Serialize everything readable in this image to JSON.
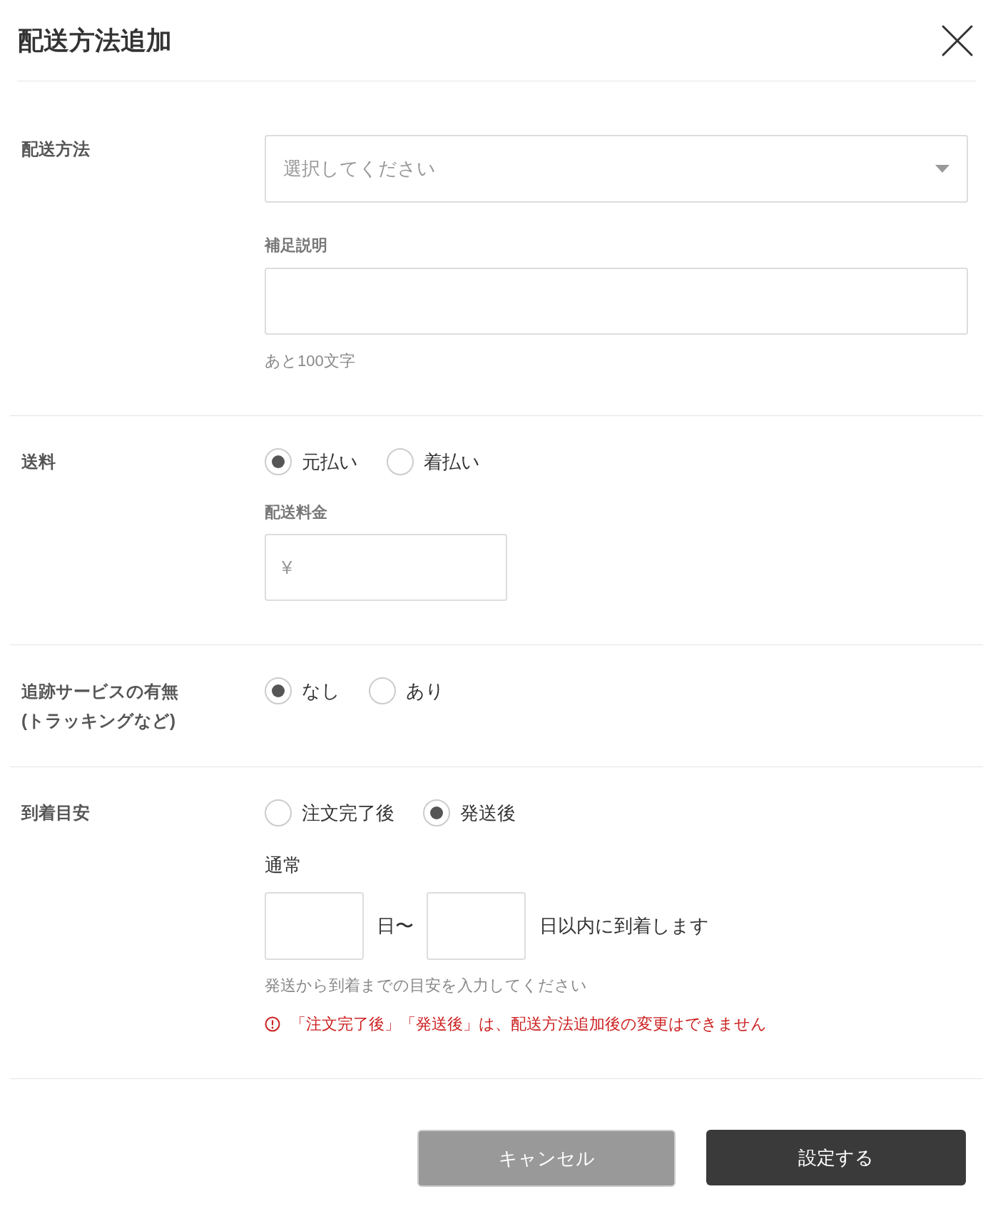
{
  "dialog": {
    "title": "配送方法追加"
  },
  "shipping_method": {
    "label": "配送方法",
    "select": {
      "placeholder": "選択してください"
    },
    "note": {
      "label": "補足説明",
      "counter": "あと100文字"
    }
  },
  "shipping_fee": {
    "label": "送料",
    "options": [
      {
        "label": "元払い",
        "selected": true
      },
      {
        "label": "着払い",
        "selected": false
      }
    ],
    "amount": {
      "label": "配送料金",
      "placeholder": "¥"
    }
  },
  "tracking": {
    "label_lines": [
      "追跡サービスの有無",
      "(トラッキングなど)"
    ],
    "options": [
      {
        "label": "なし",
        "selected": true
      },
      {
        "label": "あり",
        "selected": false
      }
    ]
  },
  "arrival": {
    "label": "到着目安",
    "options": [
      {
        "label": "注文完了後",
        "selected": false
      },
      {
        "label": "発送後",
        "selected": true
      }
    ],
    "normal": {
      "label": "通常",
      "from_suffix": "日〜",
      "to_suffix": "日以内に到着します",
      "help": "発送から到着までの目安を入力してください",
      "warning": "「注文完了後」「発送後」は、配送方法追加後の変更はできません"
    }
  },
  "buttons": [
    {
      "label": "キャンセル",
      "kind": "secondary"
    },
    {
      "label": "設定する",
      "kind": "primary"
    }
  ]
}
